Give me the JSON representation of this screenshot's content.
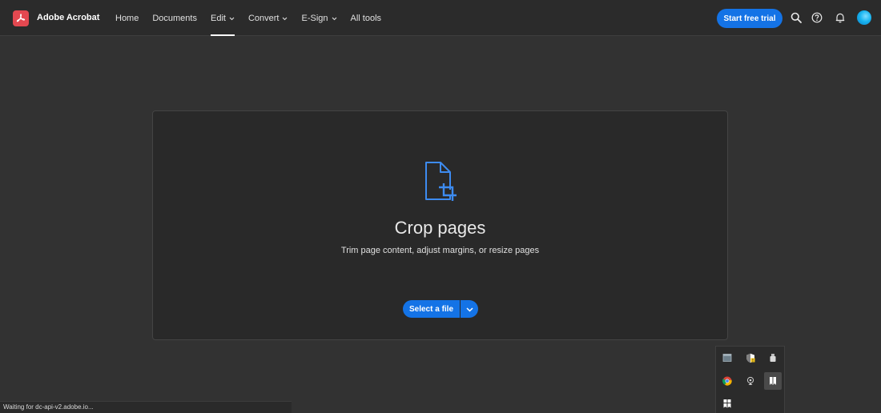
{
  "header": {
    "brand": "Adobe Acrobat",
    "logo_icon": "acrobat-logo-icon",
    "nav": [
      {
        "label": "Home",
        "dropdown": false,
        "active": false
      },
      {
        "label": "Documents",
        "dropdown": false,
        "active": false
      },
      {
        "label": "Edit",
        "dropdown": true,
        "active": true
      },
      {
        "label": "Convert",
        "dropdown": true,
        "active": false
      },
      {
        "label": "E-Sign",
        "dropdown": true,
        "active": false
      },
      {
        "label": "All tools",
        "dropdown": false,
        "active": false
      }
    ],
    "cta_label": "Start free trial",
    "icons": [
      "search-icon",
      "help-icon",
      "bell-icon",
      "avatar"
    ]
  },
  "tool": {
    "icon": "crop-pages-icon",
    "title": "Crop pages",
    "subtitle": "Trim page content, adjust margins, or resize pages",
    "select_label": "Select a file",
    "dropdown_icon": "chevron-down-icon"
  },
  "status": {
    "text": "Waiting for dc-api-v2.adobe.io..."
  },
  "tray": {
    "icons": [
      "window-app-icon",
      "shield-warning-icon",
      "usb-drive-icon",
      "chrome-icon",
      "webcam-icon",
      "bookmark-app-icon",
      "bookmark-app-2-icon"
    ]
  },
  "colors": {
    "accent": "#1473e6",
    "brand_red": "#e34850",
    "background": "#323232",
    "card": "#292929"
  }
}
